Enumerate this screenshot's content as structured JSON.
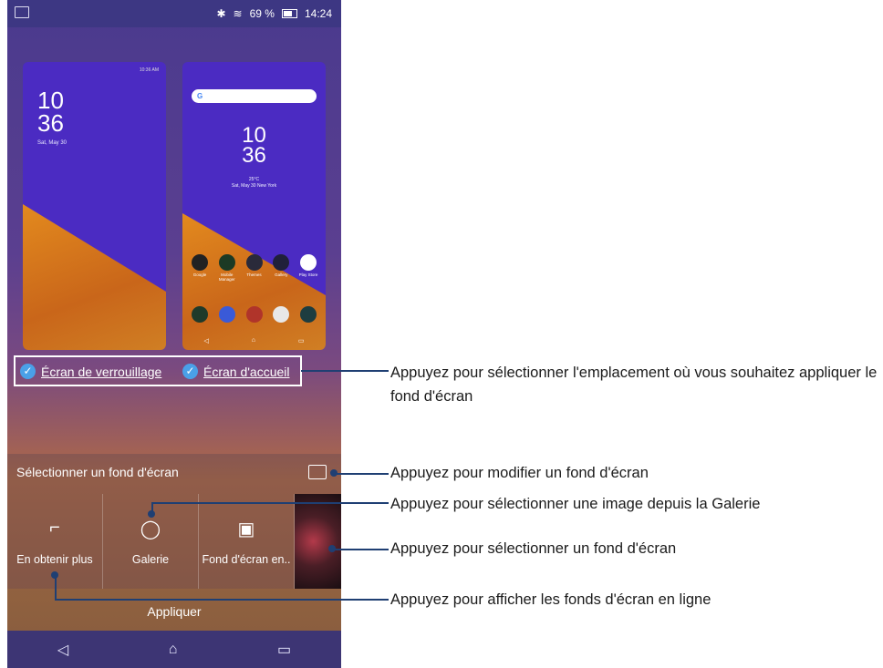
{
  "status_bar": {
    "battery": "69 %",
    "time": "14:24"
  },
  "lock_preview": {
    "mini_time": "10:36 AM",
    "hour": "10",
    "minute": "36",
    "date": "Sat, May 30"
  },
  "home_preview": {
    "hour": "10",
    "minute": "36",
    "weather": "25°C",
    "date_loc": "Sat, May 30  New York",
    "apps": [
      "Google",
      "Mobile Manager",
      "Themes",
      "Gallery",
      "Play Store"
    ]
  },
  "targets": {
    "lock": "Écran de verrouillage",
    "home": "Écran d'accueil"
  },
  "selector": {
    "title": "Sélectionner un fond d'écran"
  },
  "tiles": [
    {
      "label": "En obtenir plus",
      "icon": "paint-roller-icon"
    },
    {
      "label": "Galerie",
      "icon": "balloon-icon"
    },
    {
      "label": "Fond d'écran en..",
      "icon": "live-wallpaper-icon"
    }
  ],
  "apply_label": "Appliquer",
  "callouts": [
    "Appuyez pour sélectionner l'emplacement où vous souhaitez appliquer le fond d'écran",
    "Appuyez pour modifier un fond d'écran",
    "Appuyez pour sélectionner une image depuis la Galerie",
    "Appuyez pour sélectionner un fond d'écran",
    "Appuyez pour afficher les fonds d'écran en ligne"
  ]
}
